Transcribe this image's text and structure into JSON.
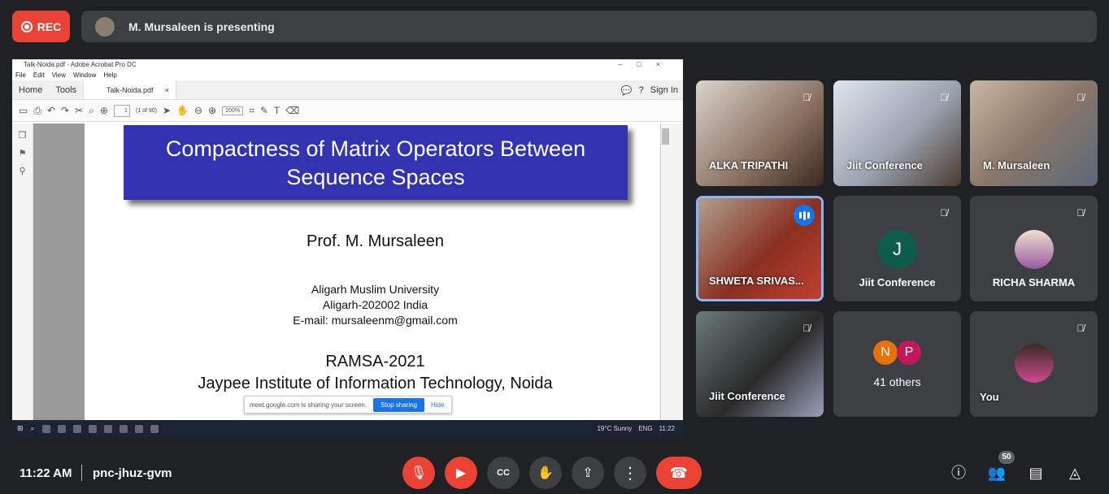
{
  "top": {
    "rec_label": "REC",
    "presenting_text": "M. Mursaleen is presenting"
  },
  "acrobat": {
    "window_title": "Talk-Noida.pdf - Adobe Acrobat Pro DC",
    "menu": [
      "File",
      "Edit",
      "View",
      "Window",
      "Help"
    ],
    "tabs": {
      "home": "Home",
      "tools": "Tools",
      "doc": "Talk-Noida.pdf",
      "close": "×"
    },
    "sign_in": "Sign In",
    "page_input": "1",
    "page_count": "(1 of 90)",
    "zoom": "200%"
  },
  "slide": {
    "title_line1": "Compactness of Matrix Operators Between",
    "title_line2": "Sequence Spaces",
    "author": "Prof. M. Mursaleen",
    "aff1": "Aligarh Muslim University",
    "aff2": "Aligarh-202002 India",
    "email": "E-mail: mursaleenm@gmail.com",
    "conf1": "RAMSA-2021",
    "conf2": "Jaypee Institute of Information Technology, Noida"
  },
  "share_notice": {
    "text": "meet.google.com is sharing your screen.",
    "stop": "Stop sharing",
    "hide": "Hide"
  },
  "taskbar": {
    "weather": "19°C  Sunny",
    "lang": "ENG",
    "time": "11:22"
  },
  "tiles": [
    {
      "name": "ALKA TRIPATHI"
    },
    {
      "name": "Jiit Conference"
    },
    {
      "name": "M. Mursaleen"
    },
    {
      "name": "SHWETA SRIVAS..."
    },
    {
      "name": "Jiit Conference",
      "initial": "J"
    },
    {
      "name": "RICHA SHARMA"
    },
    {
      "name": "Jiit Conference"
    },
    {
      "name": "41 others",
      "initials": [
        "N",
        "P"
      ]
    },
    {
      "name": "You"
    }
  ],
  "colors": {
    "j_avatar": "#0e5c4a",
    "n_avatar": "#e8710a",
    "p_avatar": "#c2185b",
    "accent": "#8ab4f8",
    "danger": "#ea4335"
  },
  "bottom": {
    "time": "11:22 AM",
    "meeting_code": "pnc-jhuz-gvm",
    "participant_count": "50"
  }
}
